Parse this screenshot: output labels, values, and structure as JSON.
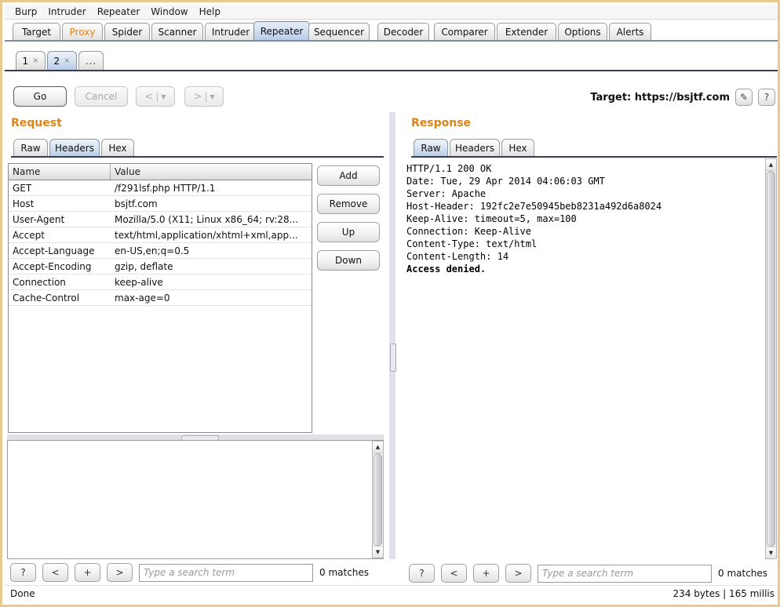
{
  "menubar": {
    "items": [
      {
        "label": "Burp"
      },
      {
        "label": "Intruder"
      },
      {
        "label": "Repeater"
      },
      {
        "label": "Window"
      },
      {
        "label": "Help"
      }
    ]
  },
  "main_tabs": [
    {
      "label": "Target",
      "selected": false,
      "accent": false
    },
    {
      "label": "Proxy",
      "selected": false,
      "accent": true
    },
    {
      "label": "Spider",
      "selected": false,
      "accent": false
    },
    {
      "label": "Scanner",
      "selected": false,
      "accent": false
    },
    {
      "label": "Intruder",
      "selected": false,
      "accent": false
    },
    {
      "label": "Repeater",
      "selected": true,
      "accent": false
    },
    {
      "label": "Sequencer",
      "selected": false,
      "accent": false
    },
    {
      "label": "Decoder",
      "selected": false,
      "accent": false
    },
    {
      "label": "Comparer",
      "selected": false,
      "accent": false
    },
    {
      "label": "Extender",
      "selected": false,
      "accent": false
    },
    {
      "label": "Options",
      "selected": false,
      "accent": false
    },
    {
      "label": "Alerts",
      "selected": false,
      "accent": false
    }
  ],
  "repeater_tabs": [
    {
      "label": "1",
      "close": "×",
      "selected": false
    },
    {
      "label": "2",
      "close": "×",
      "selected": true
    }
  ],
  "repeater_tab_more": "...",
  "toolbar": {
    "go_label": "Go",
    "cancel_label": "Cancel",
    "back_glyph": "<",
    "forward_glyph": ">",
    "caret_glyph": "▼",
    "target_label": "Target:",
    "target_url": "https://bsjtf.com",
    "edit_icon_glyph": "✎",
    "help_glyph": "?"
  },
  "request": {
    "title": "Request",
    "tabs": [
      {
        "label": "Raw",
        "selected": false
      },
      {
        "label": "Headers",
        "selected": true
      },
      {
        "label": "Hex",
        "selected": false
      }
    ],
    "columns": [
      "Name",
      "Value"
    ],
    "rows": [
      {
        "name": "GET",
        "value": "/f291lsf.php HTTP/1.1"
      },
      {
        "name": "Host",
        "value": "bsjtf.com"
      },
      {
        "name": "User-Agent",
        "value": "Mozilla/5.0 (X11; Linux x86_64; rv:28..."
      },
      {
        "name": "Accept",
        "value": "text/html,application/xhtml+xml,app..."
      },
      {
        "name": "Accept-Language",
        "value": "en-US,en;q=0.5"
      },
      {
        "name": "Accept-Encoding",
        "value": "gzip, deflate"
      },
      {
        "name": "Connection",
        "value": "keep-alive"
      },
      {
        "name": "Cache-Control",
        "value": "max-age=0"
      }
    ],
    "buttons": [
      {
        "label": "Add"
      },
      {
        "label": "Remove"
      },
      {
        "label": "Up"
      },
      {
        "label": "Down"
      }
    ]
  },
  "response": {
    "title": "Response",
    "tabs": [
      {
        "label": "Raw",
        "selected": true
      },
      {
        "label": "Headers",
        "selected": false
      },
      {
        "label": "Hex",
        "selected": false
      }
    ],
    "headers_text": "HTTP/1.1 200 OK\nDate: Tue, 29 Apr 2014 04:06:03 GMT\nServer: Apache\nHost-Header: 192fc2e7e50945beb8231a492d6a8024\nKeep-Alive: timeout=5, max=100\nConnection: Keep-Alive\nContent-Type: text/html\nContent-Length: 14\n",
    "body_text": "Access denied."
  },
  "search_left": {
    "help_glyph": "?",
    "prev_glyph": "<",
    "add_glyph": "+",
    "next_glyph": ">",
    "placeholder": "Type a search term",
    "value": "",
    "matches": "0 matches"
  },
  "search_right": {
    "help_glyph": "?",
    "prev_glyph": "<",
    "add_glyph": "+",
    "next_glyph": ">",
    "placeholder": "Type a search term",
    "value": "",
    "matches": "0 matches"
  },
  "statusbar": {
    "status": "Done",
    "metrics": "234 bytes | 165 millis"
  },
  "colors": {
    "accent": "#e08214",
    "selected_tab": "#b9cce6",
    "frame": "#e8c98e"
  }
}
